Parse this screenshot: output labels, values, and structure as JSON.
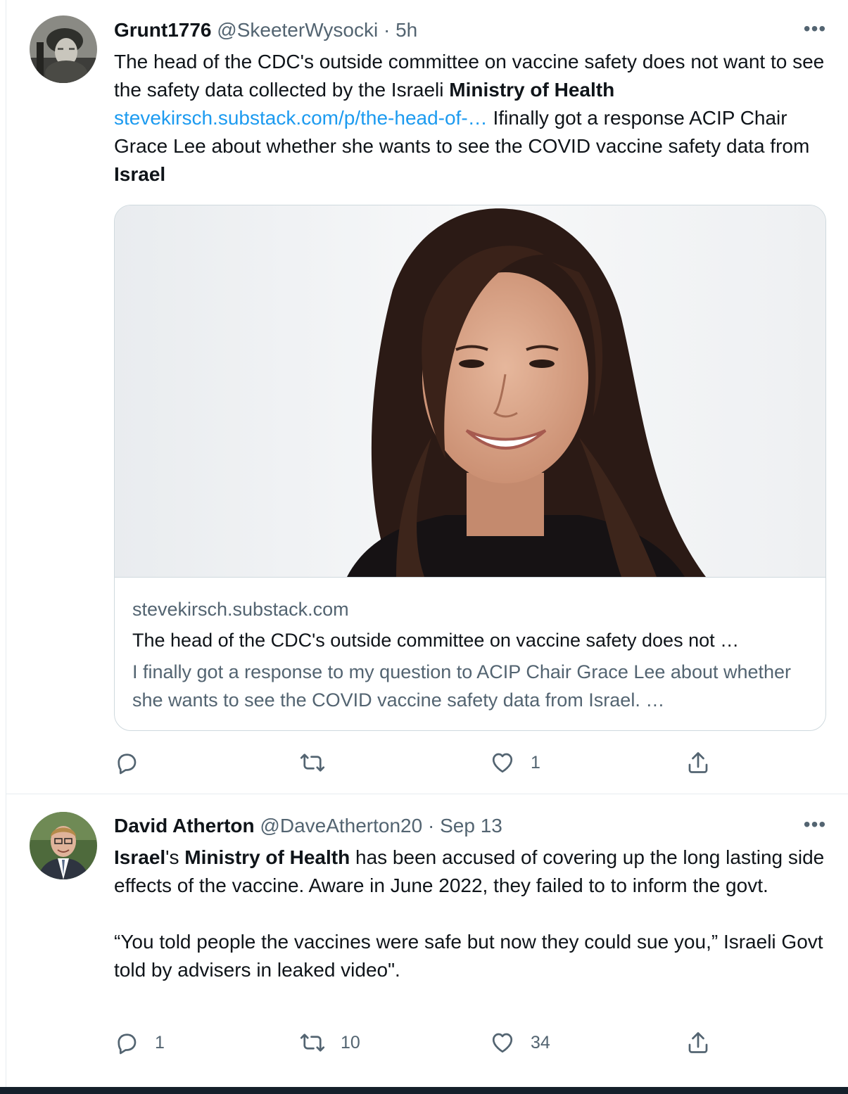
{
  "tweets": [
    {
      "name": "Grunt1776",
      "handle": "@SkeeterWysocki",
      "separator": "·",
      "time": "5h",
      "more": "•••",
      "text_parts": {
        "p1": "The head of the CDC's outside committee on vaccine safety does not want to see the safety data collected by the Israeli ",
        "b1": "Ministry of Health",
        "link": "stevekirsch.substack.com/p/the-head-of-…",
        "p2": " Ifinally got a response ACIP Chair Grace Lee about whether she wants to see the COVID vaccine safety data from ",
        "b2": "Israel"
      },
      "card": {
        "domain": "stevekirsch.substack.com",
        "title": "The head of the CDC's outside committee on vaccine safety does not …",
        "description": "I finally got a response to my question to ACIP Chair Grace Lee about whether she wants to see the COVID vaccine safety data from Israel. …"
      },
      "actions": {
        "reply_icon": "reply-icon",
        "reply_count": "",
        "retweet_icon": "retweet-icon",
        "retweet_count": "",
        "like_icon": "heart-icon",
        "like_count": "1",
        "share_icon": "share-icon"
      }
    },
    {
      "name": "David Atherton",
      "handle": "@DaveAtherton20",
      "separator": "·",
      "time": "Sep 13",
      "more": "•••",
      "text_parts": {
        "b1": "Israel",
        "p1": "'s ",
        "b2": "Ministry of Health",
        "p2": " has been accused of covering up the long lasting side effects of the vaccine. Aware in June 2022, they failed to to inform the govt.",
        "p3": "“You told people the vaccines were safe but now they could sue you,” Israeli Govt told by advisers in leaked video\"."
      },
      "actions": {
        "reply_icon": "reply-icon",
        "reply_count": "1",
        "retweet_icon": "retweet-icon",
        "retweet_count": "10",
        "like_icon": "heart-icon",
        "like_count": "34",
        "share_icon": "share-icon"
      }
    }
  ],
  "colors": {
    "link": "#1d9bf0",
    "secondary_text": "#536471",
    "primary_text": "#0f1419",
    "border": "#cfd9de",
    "bottom_bar": "#15202b"
  }
}
